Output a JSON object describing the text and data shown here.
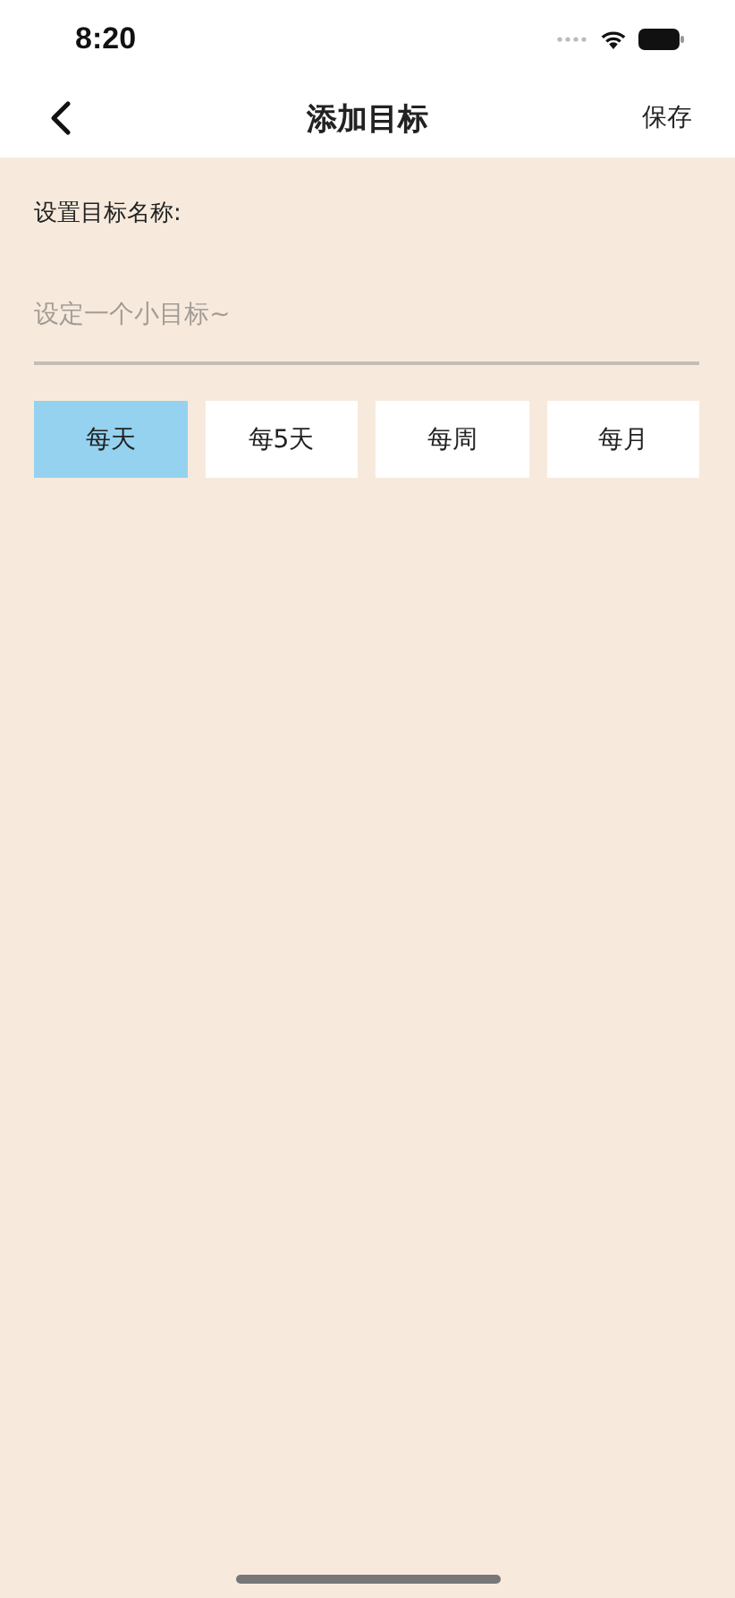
{
  "status_bar": {
    "time": "8:20"
  },
  "nav": {
    "title": "添加目标",
    "action": "保存"
  },
  "form": {
    "label": "设置目标名称:",
    "placeholder": "设定一个小目标~"
  },
  "frequency": [
    {
      "label": "每天",
      "selected": true
    },
    {
      "label": "每5天",
      "selected": false
    },
    {
      "label": "每周",
      "selected": false
    },
    {
      "label": "每月",
      "selected": false
    }
  ]
}
